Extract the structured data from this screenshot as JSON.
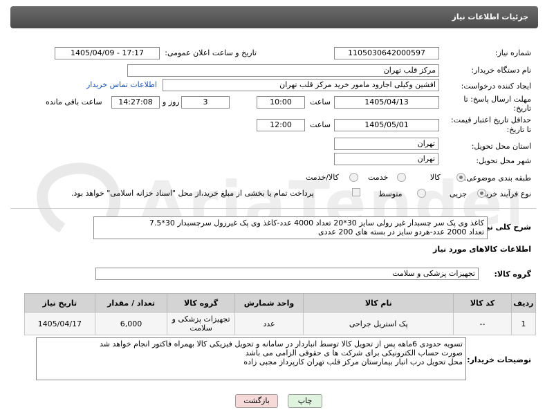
{
  "header": {
    "title": "جزئیات اطلاعات نیاز"
  },
  "fields": {
    "need_number_label": "شماره نیاز:",
    "need_number": "1105030642000597",
    "announce_label": "تاریخ و ساعت اعلان عمومی:",
    "announce_value": "1405/04/09 - 17:17",
    "buyer_org_label": "نام دستگاه خریدار:",
    "buyer_org": "مرکز قلب تهران",
    "creator_label": "ایجاد کننده درخواست:",
    "creator": "افشین وکیلی اجارود مامور خرید مرکز قلب تهران",
    "contact_link": "اطلاعات تماس خریدار",
    "reply_deadline_label_1": "مهلت ارسال پاسخ: تا",
    "reply_deadline_label_2": "تاریخ:",
    "reply_date": "1405/04/13",
    "time_label": "ساعت",
    "reply_time": "10:00",
    "days": "3",
    "day_label": "روز و",
    "remaining": "14:27:08",
    "remaining_label": "ساعت باقی مانده",
    "validity_label_1": "حداقل تاریخ اعتبار قیمت:",
    "validity_label_2": "تا تاریخ:",
    "validity_date": "1405/05/01",
    "validity_time": "12:00",
    "province_label": "استان محل تحویل:",
    "province": "تهران",
    "city_label": "شهر محل تحویل:",
    "city": "تهران",
    "category_label": "طبقه بندی موضوعی:",
    "category_options": [
      "کالا",
      "خدمت",
      "کالا/خدمت"
    ],
    "process_label": "نوع فرآیند خرید :",
    "process_options": [
      "جزیی",
      "متوسط"
    ],
    "payment_note": "پرداخت تمام یا بخشی از مبلغ خرید،از محل \"اسناد خزانه اسلامی\" خواهد بود."
  },
  "summary": {
    "label": "شرح کلی نیاز:",
    "text_line1": "کاغذ وی پک سر چسبدار غیر رولی سایز 30*20 تعداد 4000 عدد-کاغذ وی پک غیررول سرچسبدار 30*7.5",
    "text_line2": "تعداد 2000 عدد-هردو سایز در بسته های 200 عددی"
  },
  "goods_info_title": "اطلاعات کالاهای مورد نیاز",
  "goods_group": {
    "label": "گروه کالا:",
    "value": "تجهیزات پزشکی و سلامت"
  },
  "table": {
    "headers": [
      "ردیف",
      "کد کالا",
      "نام کالا",
      "واحد شمارش",
      "گروه کالا",
      "تعداد / مقدار",
      "تاریخ نیاز"
    ],
    "rows": [
      [
        "1",
        "--",
        "پک استریل جراحی",
        "عدد",
        "تجهیزات پزشکی و سلامت",
        "6,000",
        "1405/04/17"
      ]
    ]
  },
  "buyer_notes": {
    "label": "توضیحات خریدار:",
    "line1": "تسویه حدودی 6ماهه پس از تحویل کالا توسط انباردار در سامانه و تحویل فیزیکی کالا بهمراه فاکتور انجام خواهد شد",
    "line2": "صورت حساب الکترونیکی برای شرکت ها ی حقوقی الزامی می باشد",
    "line3": "محل تحویل درب انبار بیمارستان مرکز قلب تهران کارپرداز مجبی زاده"
  },
  "buttons": {
    "print": "چاپ",
    "back": "بازگشت"
  },
  "colors": {
    "header_bg": "#4a4a4a",
    "link": "#1a4fb0",
    "back_btn_bg": "#f6d9d9",
    "print_btn_bg": "#dff3df"
  }
}
